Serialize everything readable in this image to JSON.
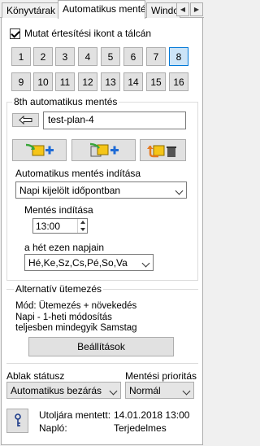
{
  "tabs": [
    "Könyvtárak",
    "Automatikus mentés",
    "Windov"
  ],
  "active_tab": 1,
  "show_icon": {
    "label": "Mutat értesítési ikont a tálcán",
    "checked": true
  },
  "day_buttons": [
    "1",
    "2",
    "3",
    "4",
    "5",
    "6",
    "7",
    "8",
    "9",
    "10",
    "11",
    "12",
    "13",
    "14",
    "15",
    "16"
  ],
  "selected_day": "8",
  "slot": {
    "title": "8th  automatikus mentés",
    "plan_name": "test-plan-4"
  },
  "start": {
    "label": "Automatikus mentés indítása",
    "mode": "Napi kijelölt időpontban",
    "time_label": "Mentés indítása",
    "time": "13:00",
    "days_label": "a hét ezen napjain",
    "days": "Hé,Ke,Sz,Cs,Pé,So,Va"
  },
  "alt": {
    "title": "Alternatív ütemezés",
    "lines": [
      "Mód: Ütemezés + növekedés",
      "Napi - 1-heti módosítás",
      "teljesben mindegyik Samstag"
    ],
    "settings_button": "Beállítások"
  },
  "window_status": {
    "label": "Ablak státusz",
    "value": "Automatikus bezárás"
  },
  "priority": {
    "label": "Mentési prioritás",
    "value": "Normál"
  },
  "last_saved_label": "Utoljára mentett:",
  "last_saved_value": "14.01.2018 13:00",
  "log_label": "Napló:",
  "log_value": "Terjedelmes",
  "colors": {
    "selected_day_bg": "#cce4f7",
    "selected_day_border": "#0078d7",
    "icon_yellow": "#f5c518",
    "icon_green": "#3aa63a",
    "icon_blue": "#1e6bd6",
    "icon_orange": "#e57a1f"
  }
}
